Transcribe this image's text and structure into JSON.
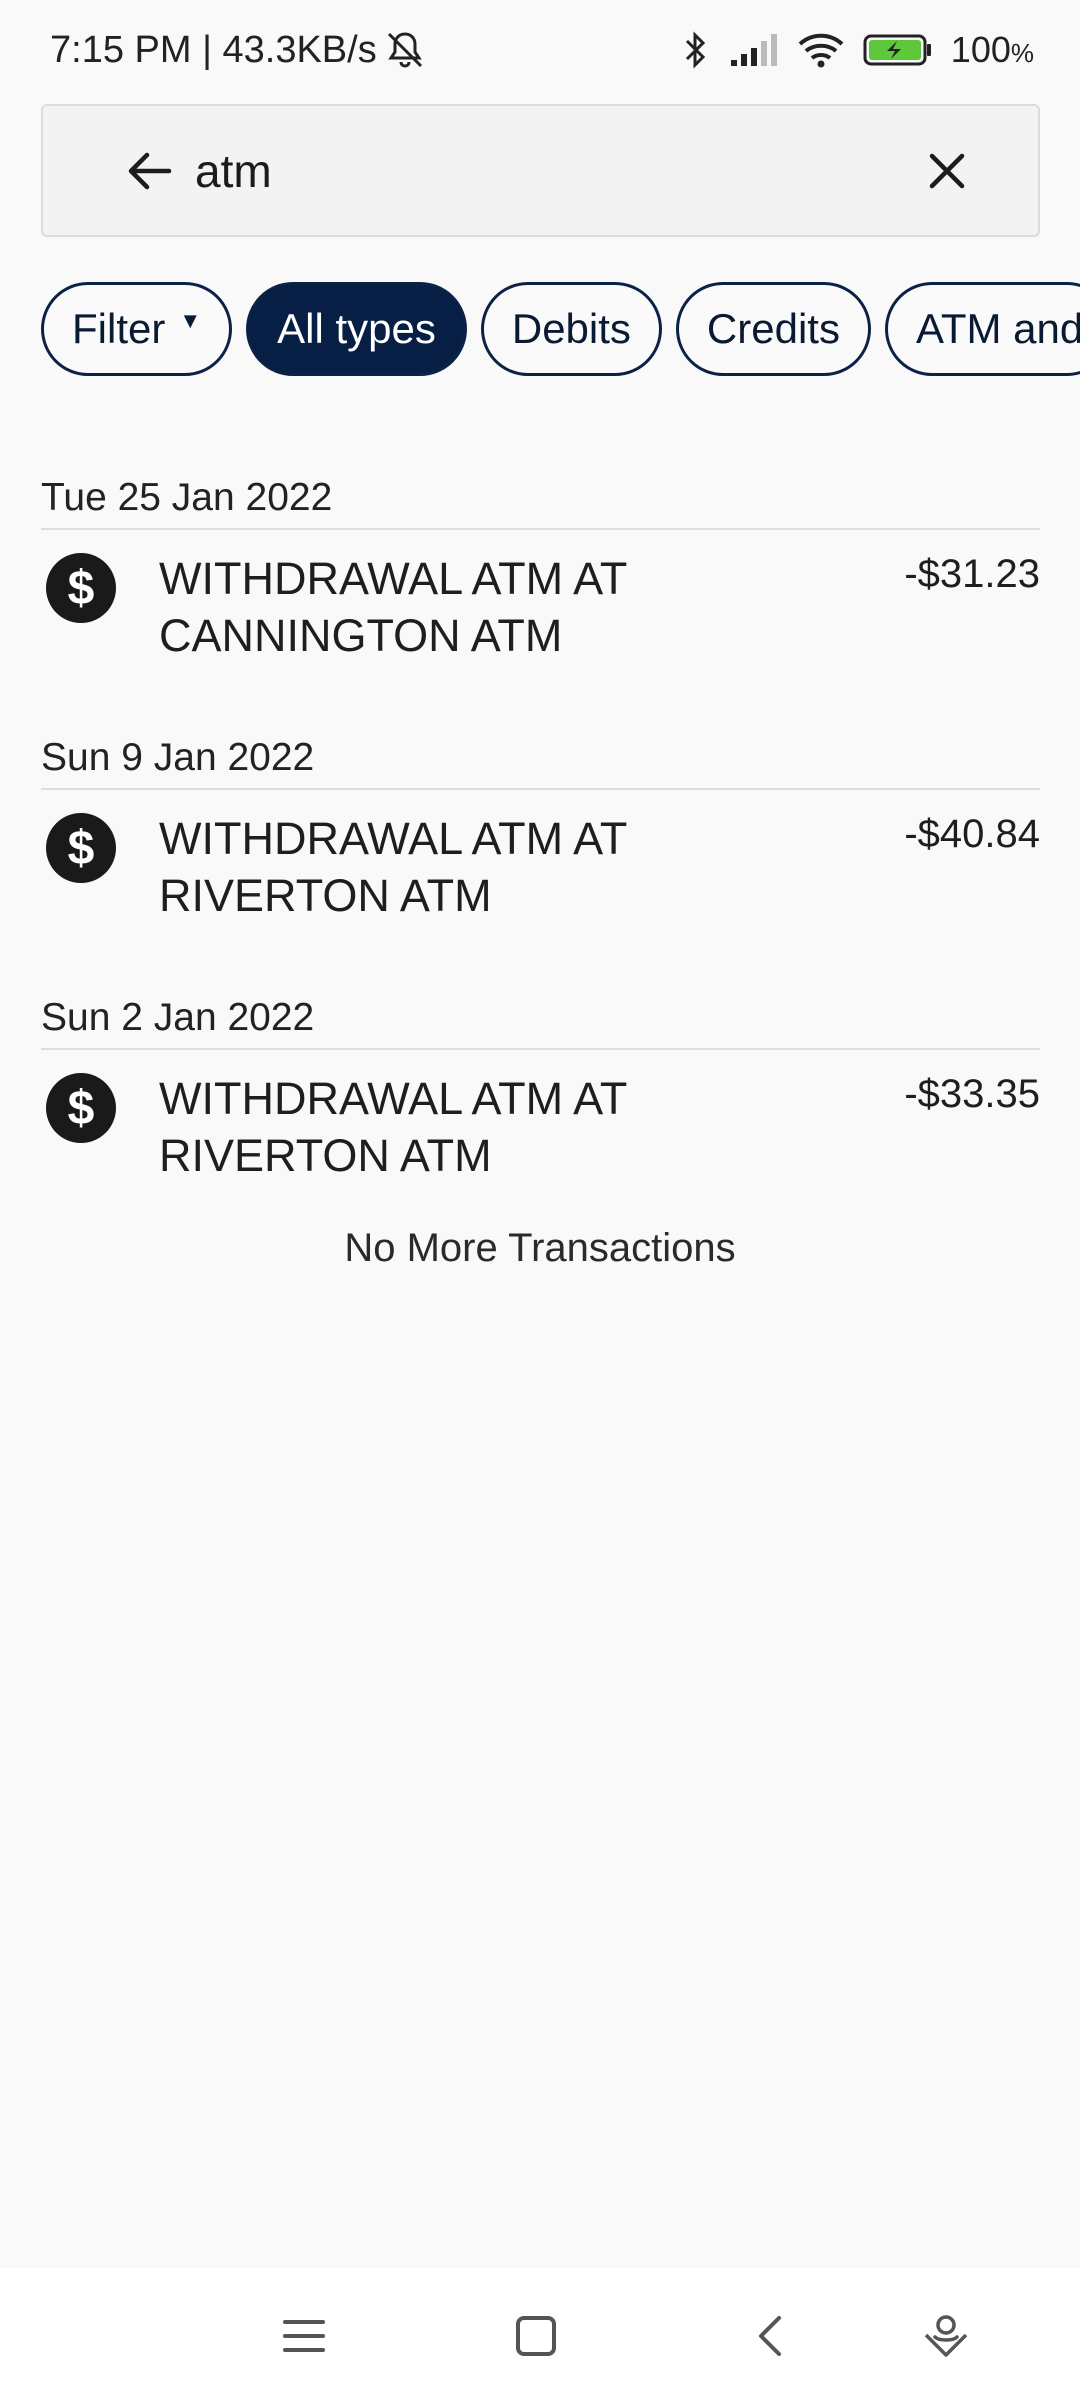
{
  "status_bar": {
    "time_speed": "7:15 PM | 43.3KB/s",
    "battery_percent": "100",
    "battery_unit": "%",
    "icons": [
      "mute-bell-icon",
      "bluetooth-icon",
      "signal-icon",
      "wifi-icon",
      "battery-charging-icon"
    ]
  },
  "search": {
    "value": "atm",
    "placeholder": "",
    "back_icon": "arrow-left-icon",
    "clear_icon": "close-icon"
  },
  "chips": [
    {
      "label": "Filter",
      "has_dropdown": true,
      "active": false
    },
    {
      "label": "All types",
      "active": true
    },
    {
      "label": "Debits",
      "active": false
    },
    {
      "label": "Credits",
      "active": false
    },
    {
      "label": "ATM and",
      "active": false
    }
  ],
  "transactions": [
    {
      "date": "Tue 25 Jan 2022",
      "description_line1": "WITHDRAWAL ATM AT",
      "description_line2": "CANNINGTON ATM",
      "amount": "-$31.23",
      "icon": "dollar-circle-icon"
    },
    {
      "date": "Sun 9 Jan 2022",
      "description_line1": "WITHDRAWAL ATM AT",
      "description_line2": "RIVERTON ATM",
      "amount": "-$40.84",
      "icon": "dollar-circle-icon"
    },
    {
      "date": "Sun 2 Jan 2022",
      "description_line1": "WITHDRAWAL ATM AT",
      "description_line2": "RIVERTON ATM",
      "amount": "-$33.35",
      "icon": "dollar-circle-icon"
    }
  ],
  "footer_text": "No More Transactions",
  "nav_bar": {
    "icons": [
      "menu-icon",
      "home-square-icon",
      "back-chevron-icon",
      "assistant-icon"
    ]
  },
  "colors": {
    "accent": "#071e45",
    "background": "#f9f9f9",
    "battery_fill": "#5dc93a"
  }
}
